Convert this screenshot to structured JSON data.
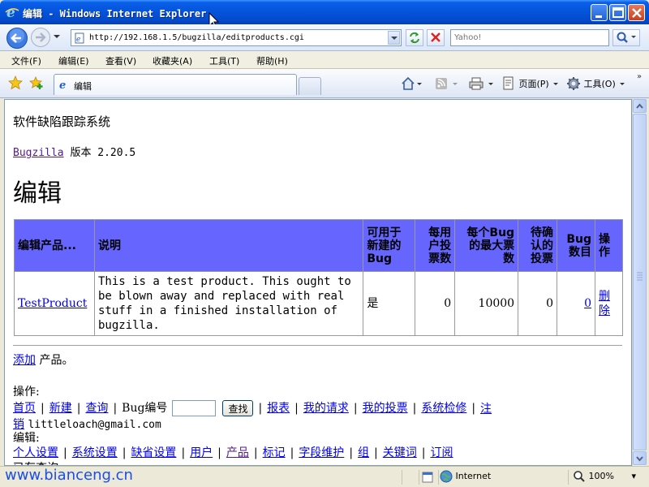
{
  "window": {
    "title": "编辑 - Windows Internet Explorer"
  },
  "nav": {
    "url": "http://192.168.1.5/bugzilla/editproducts.cgi",
    "search_placeholder": "Yahoo!"
  },
  "menu": [
    {
      "label": "文件(F)"
    },
    {
      "label": "编辑(E)"
    },
    {
      "label": "查看(V)"
    },
    {
      "label": "收藏夹(A)"
    },
    {
      "label": "工具(T)"
    },
    {
      "label": "帮助(H)"
    }
  ],
  "tabs": {
    "active": "编辑",
    "page_tool": "页面(P)",
    "tools_tool": "工具(O)"
  },
  "page": {
    "system_title": "软件缺陷跟踪系统",
    "product_link": "Bugzilla",
    "version_text": " 版本 2.20.5",
    "heading": "编辑",
    "table": {
      "headers": [
        "编辑产品...",
        "说明",
        "可用于新建的Bug",
        "每用户投票数",
        "每个Bug的最大票数",
        "待确认的投票",
        "Bug数目",
        "操作"
      ],
      "rows": [
        {
          "product": "TestProduct",
          "description": "This is a test product. This ought to be blown away and replaced with real stuff in a finished installation of bugzilla.",
          "open_for_bugs": "是",
          "votes_per_user": "0",
          "max_votes_per_bug": "10000",
          "votes_to_confirm": "0",
          "bug_count": "0",
          "action": "删除"
        }
      ]
    },
    "add_link": "添加",
    "add_suffix": " 产品。",
    "actions_label": "操作:",
    "actions": [
      "首页",
      "新建",
      "查询"
    ],
    "bug_number_label": "Bug编号",
    "find_button": "查找",
    "actions2": [
      "报表",
      "我的请求",
      "我的投票",
      "系统检修",
      "注销"
    ],
    "logout_rest": "销",
    "user_email": "littleloach@gmail.com",
    "edit_label": "编辑:",
    "edit_links": [
      "个人设置",
      "系统设置",
      "缺省设置",
      "用户",
      "产品",
      "标记",
      "字段维护",
      "组",
      "关键词",
      "订阅"
    ],
    "partial_text": "已存查询"
  },
  "status": {
    "watermark": "www.bianceng.cn",
    "zone": "Internet",
    "zoom": "100%"
  }
}
